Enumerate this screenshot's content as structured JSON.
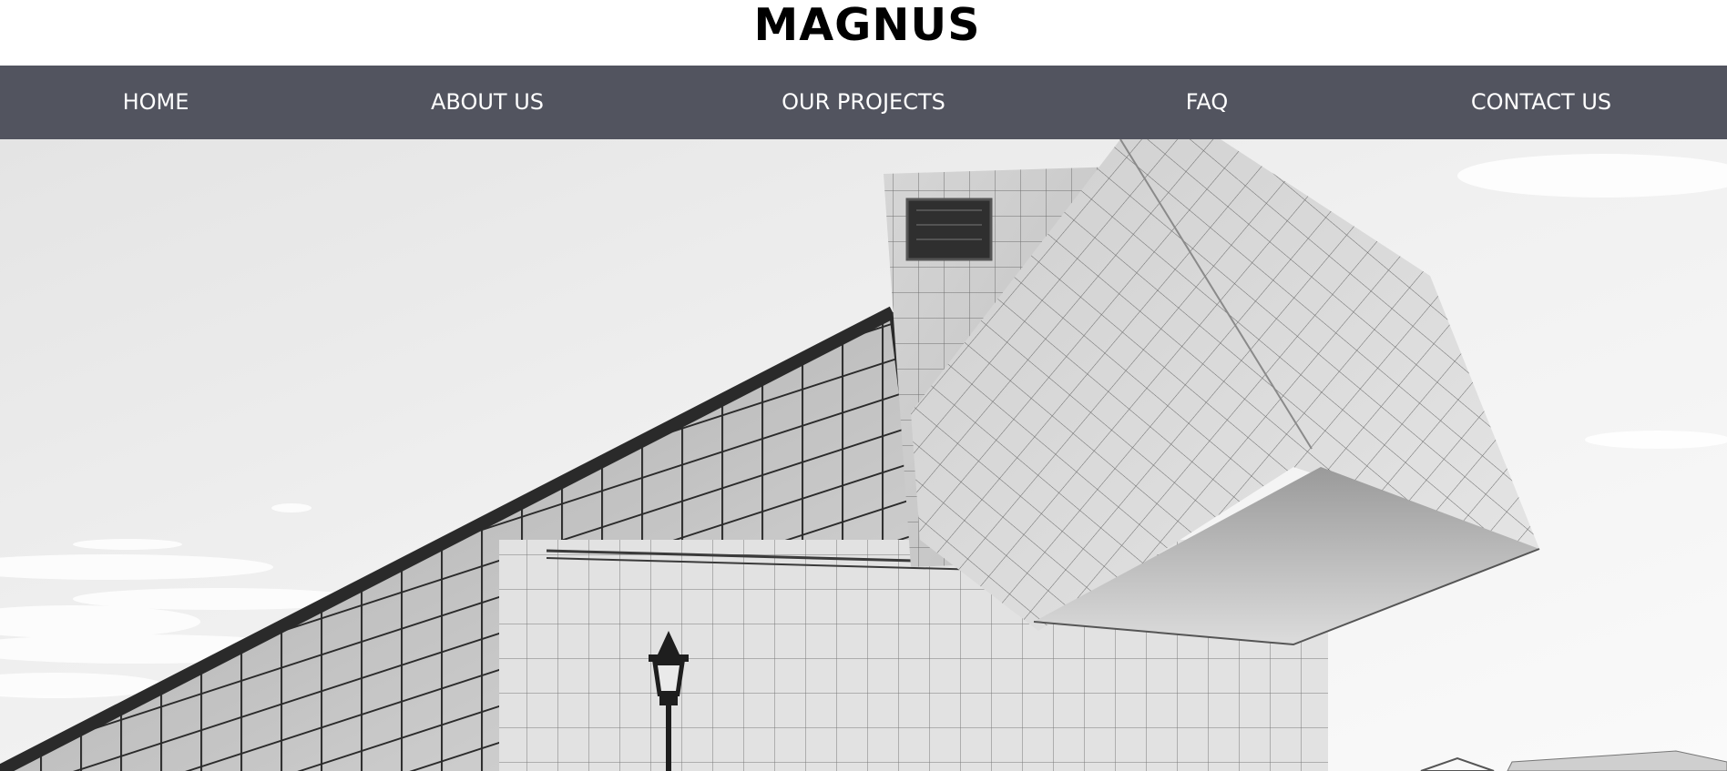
{
  "header": {
    "brand": "MAGNUS"
  },
  "nav": {
    "items": [
      {
        "label": "HOME"
      },
      {
        "label": "ABOUT US"
      },
      {
        "label": "OUR PROJECTS"
      },
      {
        "label": "FAQ"
      },
      {
        "label": "CONTACT US"
      }
    ]
  },
  "colors": {
    "nav_background": "#52545f",
    "nav_text": "#ffffff",
    "brand_text": "#000000"
  },
  "hero": {
    "image": "grayscale-modern-glass-building-photo"
  }
}
